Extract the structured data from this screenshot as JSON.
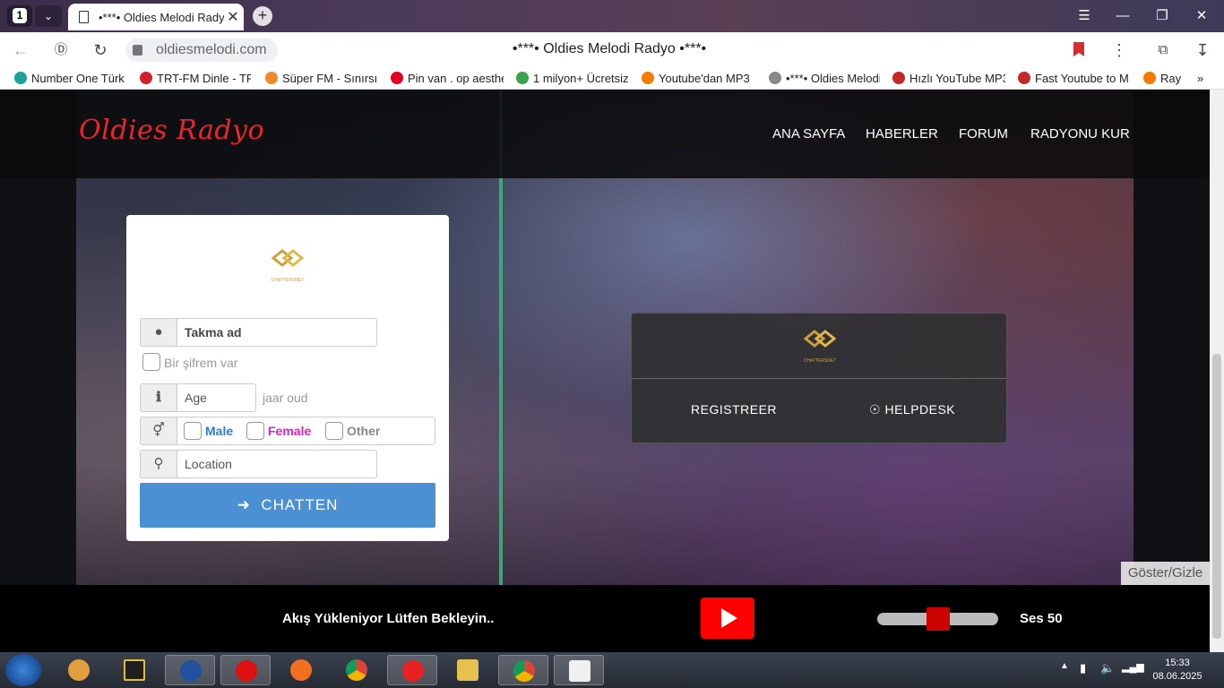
{
  "browser": {
    "tab_count": "1",
    "tab_title": "•***• Oldies Melodi Radyo •***•",
    "url": "oldiesmelodi.com",
    "page_title": "•***• Oldies Melodi Radyo •***•",
    "bookmarks": [
      {
        "label": "Number One Türk",
        "color": "#1aa39a"
      },
      {
        "label": "TRT-FM Dinle - TR",
        "color": "#d3202f"
      },
      {
        "label": "Süper FM - Sınırsız",
        "color": "#f08a24"
      },
      {
        "label": "Pin van . op aesthe",
        "color": "#e60023"
      },
      {
        "label": "1 milyon+ Ücretsiz",
        "color": "#3aa34b"
      },
      {
        "label": "Youtube'dan MP3",
        "color": "#f57c00"
      },
      {
        "label": "•***• Oldies Melodi",
        "color": "#888888"
      },
      {
        "label": "Hızlı YouTube MP3",
        "color": "#c62828"
      },
      {
        "label": "Fast Youtube to M",
        "color": "#c62828"
      },
      {
        "label": "Ray",
        "color": "#f57c00"
      }
    ]
  },
  "site": {
    "logo": "Oldies Radyo",
    "nav": [
      "ANA SAYFA",
      "HABERLER",
      "FORUM",
      "RADYONU KUR"
    ]
  },
  "login": {
    "brand": "CHATTERSNET",
    "nickname_placeholder": "Takma ad",
    "password_toggle": "Bir şifrem var",
    "age_placeholder": "Age",
    "age_suffix": "jaar oud",
    "gender": {
      "male": "Male",
      "female": "Female",
      "other": "Other"
    },
    "location_placeholder": "Location",
    "submit": "CHATTEN"
  },
  "help": {
    "brand": "CHATTERSNET",
    "register": "REGISTREER",
    "helpdesk": "HELPDESK"
  },
  "toggle": "Göster/Gizle",
  "player": {
    "status": "Akış Yükleniyor Lütfen Bekleyin..",
    "volume_label": "Ses 50",
    "volume_level": 50
  },
  "taskbar": {
    "time": "15:33",
    "date": "08.06.2025"
  }
}
